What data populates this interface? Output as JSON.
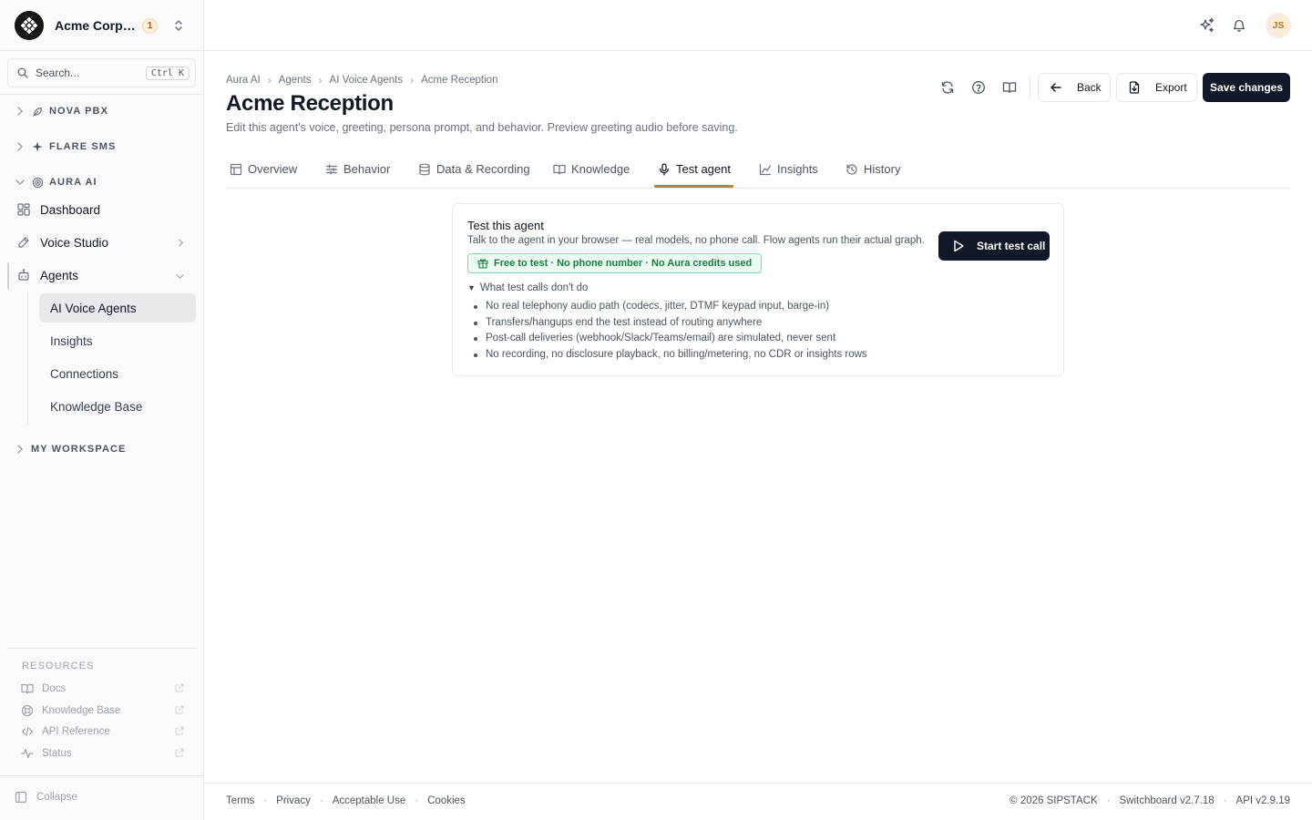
{
  "org": {
    "name": "Acme Corporation",
    "badge": "1"
  },
  "search": {
    "placeholder": "Search...",
    "shortcut": "Ctrl K"
  },
  "sidebar": {
    "sections": [
      {
        "label": "NOVA PBX",
        "icon": "leaf-icon",
        "expanded": false
      },
      {
        "label": "FLARE SMS",
        "icon": "sparkle-icon",
        "expanded": false
      },
      {
        "label": "AURA AI",
        "icon": "radar-icon",
        "expanded": true
      },
      {
        "label": "MY WORKSPACE",
        "icon": "",
        "expanded": false
      }
    ],
    "items": [
      {
        "label": "Dashboard",
        "icon": "dashboard-icon"
      },
      {
        "label": "Voice Studio",
        "icon": "pen-icon"
      },
      {
        "label": "Agents",
        "icon": "bot-icon"
      }
    ],
    "agent_subitems": [
      {
        "label": "AI Voice Agents",
        "active": true
      },
      {
        "label": "Insights",
        "active": false
      },
      {
        "label": "Connections",
        "active": false
      },
      {
        "label": "Knowledge Base",
        "active": false
      }
    ],
    "resources_title": "RESOURCES",
    "resources": [
      {
        "label": "Docs",
        "icon": "book-icon"
      },
      {
        "label": "Knowledge Base",
        "icon": "lifebuoy-icon"
      },
      {
        "label": "API Reference",
        "icon": "code-icon"
      },
      {
        "label": "Status",
        "icon": "activity-icon"
      }
    ],
    "collapse_label": "Collapse"
  },
  "header": {
    "avatar_initials": "JS"
  },
  "breadcrumb": [
    "Aura AI",
    "Agents",
    "AI Voice Agents",
    "Acme Reception"
  ],
  "page": {
    "title": "Acme Reception",
    "description": "Edit this agent's voice, greeting, persona prompt, and behavior. Preview greeting audio before saving."
  },
  "actions": {
    "back": "Back",
    "export": "Export",
    "save": "Save changes"
  },
  "tabs": [
    {
      "label": "Overview",
      "icon": "layout-icon"
    },
    {
      "label": "Behavior",
      "icon": "sliders-icon"
    },
    {
      "label": "Data & Recording",
      "icon": "database-icon"
    },
    {
      "label": "Knowledge",
      "icon": "book-open-icon"
    },
    {
      "label": "Test agent",
      "icon": "mic-icon",
      "active": true
    },
    {
      "label": "Insights",
      "icon": "chart-icon"
    },
    {
      "label": "History",
      "icon": "history-icon"
    }
  ],
  "test_card": {
    "title": "Test this agent",
    "subtitle": "Talk to the agent in your browser — real models, no phone call. Flow agents run their actual graph.",
    "badge": "Free to test · No phone number · No Aura credits used",
    "button": "Start test call",
    "details_summary": "What test calls don't do",
    "limitations": [
      "No real telephony audio path (codecs, jitter, DTMF keypad input, barge-in)",
      "Transfers/hangups end the test instead of routing anywhere",
      "Post-call deliveries (webhook/Slack/Teams/email) are simulated, never sent",
      "No recording, no disclosure playback, no billing/metering, no CDR or insights rows"
    ]
  },
  "footer": {
    "links": [
      "Terms",
      "Privacy",
      "Acceptable Use",
      "Cookies"
    ],
    "copyright": "© 2026 SIPSTACK",
    "switchboard_version": "Switchboard v2.7.18",
    "api_version": "API v2.9.19"
  },
  "colors": {
    "primary": "#111827",
    "tab_accent": "#b7853a",
    "success_bg": "#ecfdf3",
    "success_text": "#15803d",
    "badge_amber": "#b45309"
  }
}
